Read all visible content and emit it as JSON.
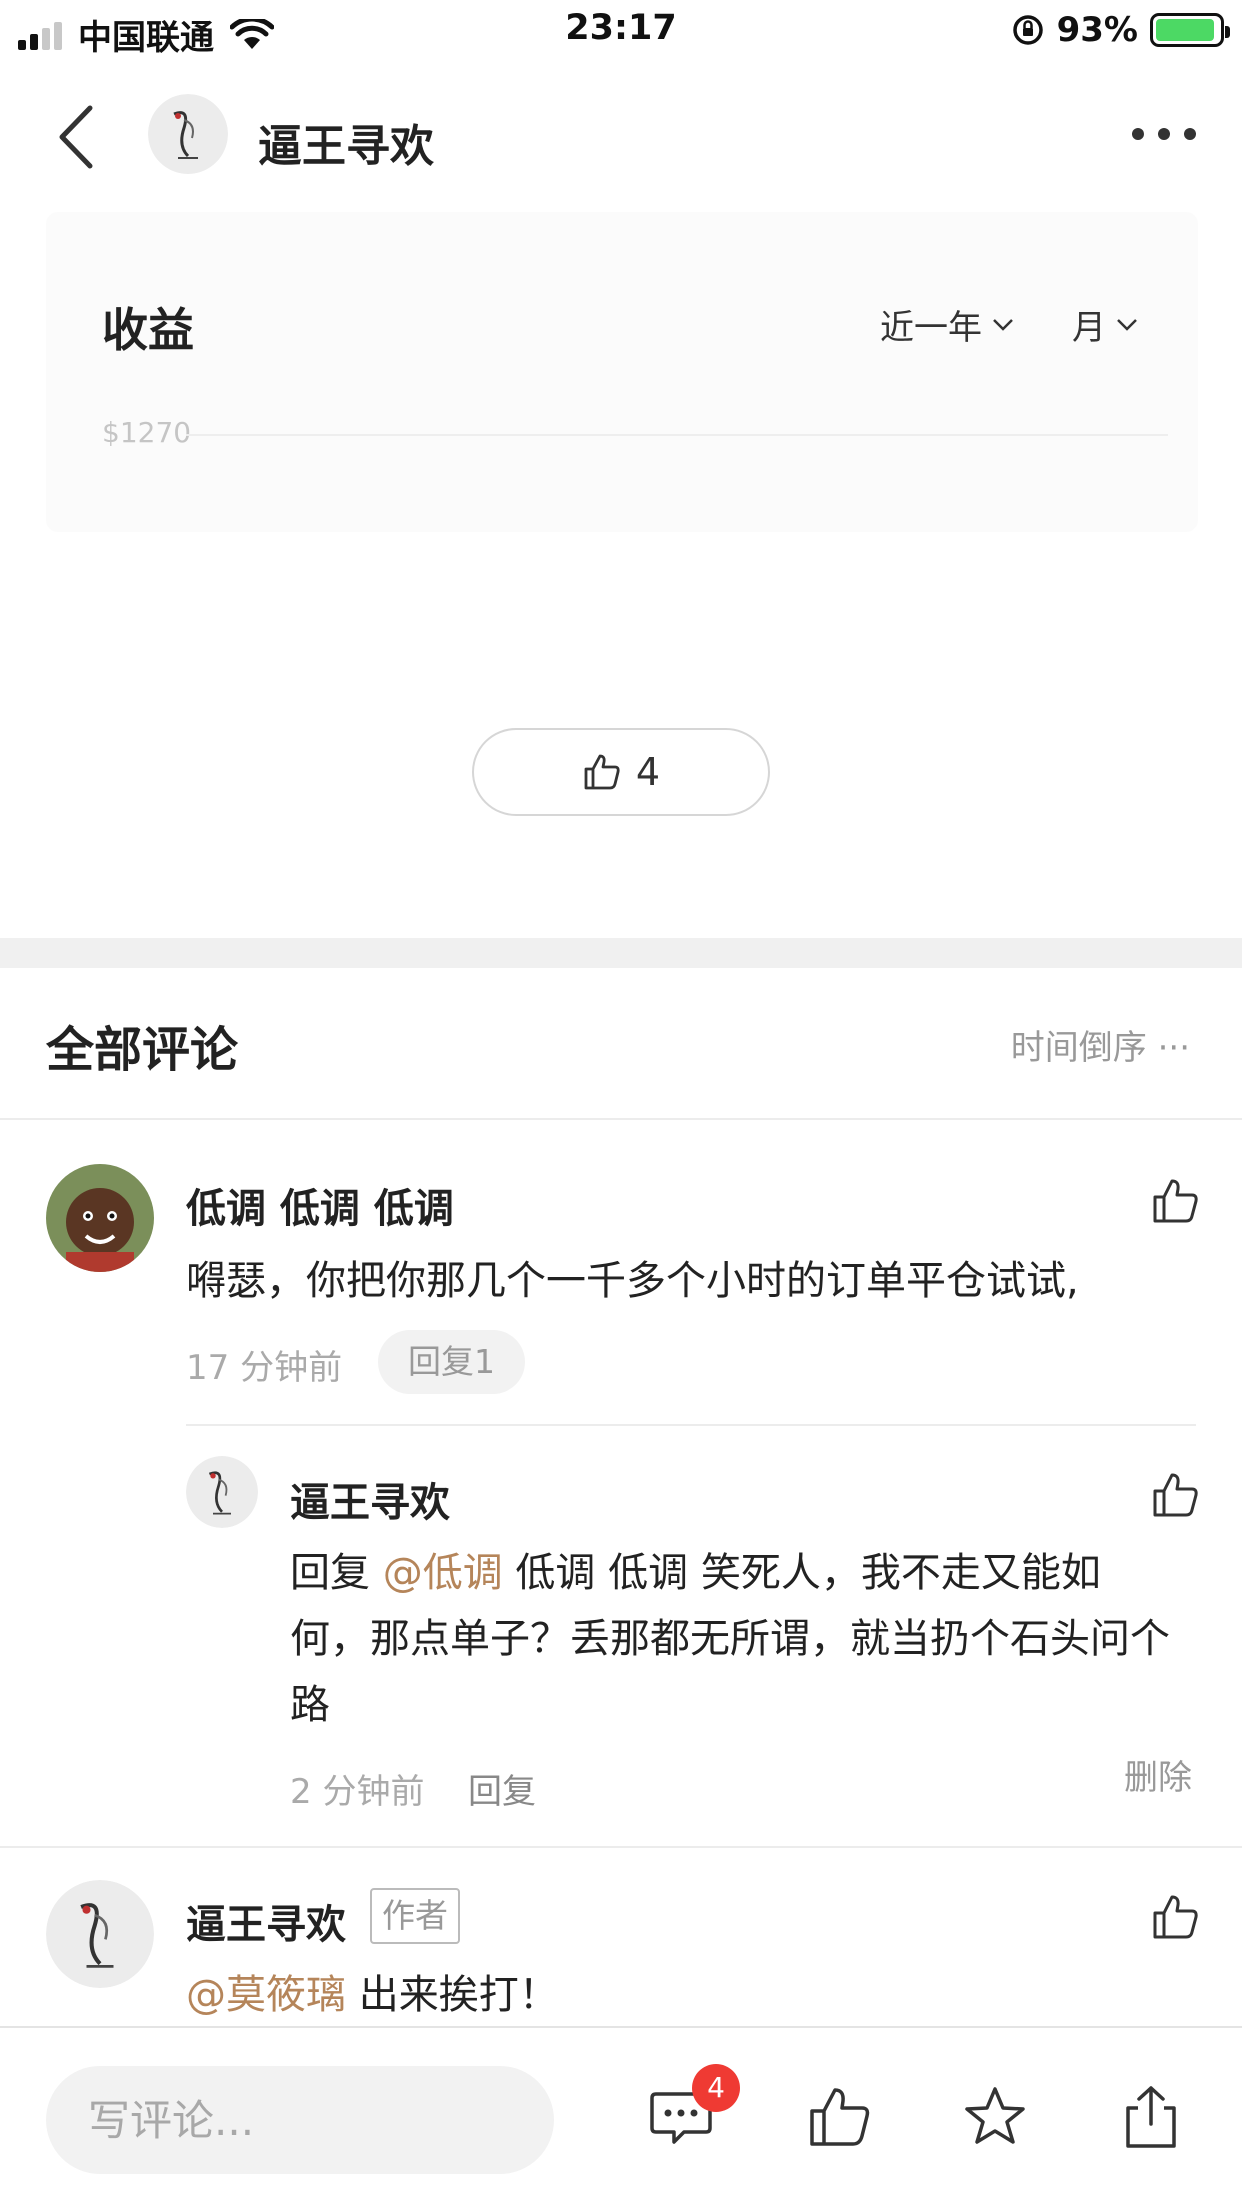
{
  "status_bar": {
    "carrier": "中国联通",
    "time": "23:17",
    "battery_percent": "93%",
    "battery_level": 0.93,
    "signal_bars": 4,
    "signal_active": 2
  },
  "nav": {
    "title": "逼王寻欢"
  },
  "earnings": {
    "title": "收益",
    "range_label": "近一年",
    "period_label": "月",
    "axis_label": "$1270"
  },
  "likes": {
    "count": "4"
  },
  "comments": {
    "title": "全部评论",
    "sort_label": "时间倒序 ···",
    "items": [
      {
        "name": "低调 低调 低调",
        "text": "嘚瑟，你把你那几个一千多个小时的订单平仓试试,",
        "time": "17 分钟前",
        "reply_label": "回复1"
      },
      {
        "name": "逼王寻欢",
        "reply_prefix": "回复 ",
        "mention": "@低调",
        "text": " 低调 低调 笑死人，我不走又能如何，那点单子？丢那都无所谓，就当扔个石头问个路",
        "time": "2 分钟前",
        "reply_label": "回复",
        "delete_label": "删除"
      },
      {
        "name": "逼王寻欢",
        "badge": "作者",
        "mention": "@莫筱璃",
        "text": " 出来挨打！"
      }
    ]
  },
  "bottom_bar": {
    "input_placeholder": "写评论...",
    "comment_badge": "4",
    "icons": [
      "comment-icon",
      "thumbs-up-icon",
      "star-icon",
      "share-icon"
    ]
  },
  "colors": {
    "mention": "#b5855a",
    "badge": "#ef3a33",
    "battery": "#4cd964"
  }
}
